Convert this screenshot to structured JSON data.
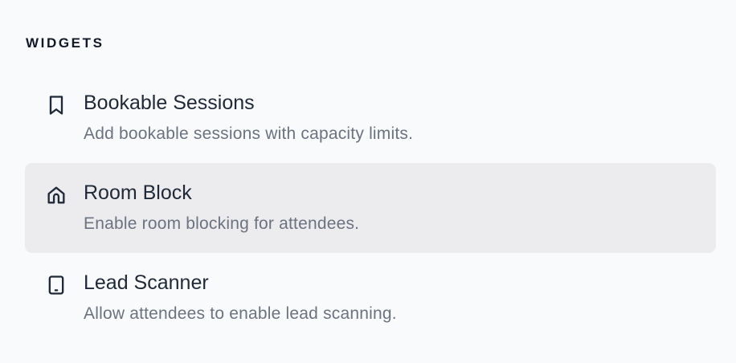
{
  "section": {
    "title": "WIDGETS"
  },
  "widgets": [
    {
      "icon": "bookmark-icon",
      "title": "Bookable Sessions",
      "description": "Add bookable sessions with capacity limits.",
      "selected": false
    },
    {
      "icon": "home-icon",
      "title": "Room Block",
      "description": "Enable room blocking for attendees.",
      "selected": true
    },
    {
      "icon": "tablet-icon",
      "title": "Lead Scanner",
      "description": "Allow attendees to enable lead scanning.",
      "selected": false
    }
  ],
  "colors": {
    "background": "#f9fafb",
    "selected_background": "#ececee",
    "title_text": "#1f2937",
    "description_text": "#6b7280"
  }
}
